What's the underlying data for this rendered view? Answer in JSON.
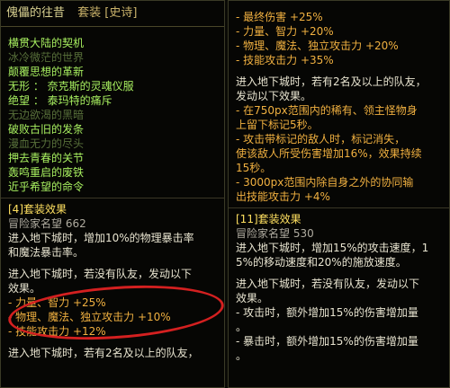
{
  "left": {
    "title": "傀儡的往昔",
    "set_label": "套装 [史诗]",
    "items": [
      {
        "text": "横贯大陆的契机",
        "active": true
      },
      {
        "text": "冰冷微茫的世界",
        "active": false
      },
      {
        "text": "颠覆思想的革新",
        "active": true
      },
      {
        "text": "无形 ： 奈克斯的灵魂仪服",
        "active": true
      },
      {
        "text": "绝望 ： 泰玛特的痛斥",
        "active": true
      },
      {
        "text": "无边欲渴的黑暗",
        "active": false
      },
      {
        "text": "破败古旧的发条",
        "active": true
      },
      {
        "text": "漫血无力的尽头",
        "active": false
      },
      {
        "text": "押去青春的关节",
        "active": true
      },
      {
        "text": "轰鸣重启的废铁",
        "active": true
      },
      {
        "text": "近乎希望的命令",
        "active": true
      }
    ],
    "set4": {
      "header": "[4]套装效果",
      "fame": "冒险家名望 662",
      "desc": [
        "进入地下城时，增加10%的物理暴击率",
        "和魔法暴击率。"
      ],
      "cond": [
        "进入地下城时，若没有队友，发动以下",
        "效果。"
      ],
      "stats": [
        "- 力量、智力 +25%",
        "- 物理、魔法、独立攻击力 +10%",
        "- 技能攻击力 +12%"
      ],
      "cut": "进入地下城时，若有2名及以上的队友，"
    }
  },
  "right": {
    "top_stats": [
      "- 最终伤害 +25%",
      "- 力量、智力 +20%",
      "- 物理、魔法、独立攻击力 +20%",
      "- 技能攻击力 +35%"
    ],
    "party": [
      "进入地下城时，若有2名及以上的队友，",
      "发动以下效果。"
    ],
    "mark": [
      "- 在750px范围内的稀有、领主怪物身",
      "上留下标记5秒。"
    ],
    "mark_attack": [
      "- 攻击带标记的敌人时，标记消失，",
      "使该敌人所受伤害增加16%，效果持续",
      "15秒。"
    ],
    "other": [
      "- 3000px范围内除自身之外的协同输",
      "出技能攻击力 +4%"
    ],
    "set11": {
      "header": "[11]套装效果",
      "fame": "冒险家名望 530",
      "desc": [
        "进入地下城时，增加15%的攻击速度，1",
        "5%的移动速度和20%的施放速度。"
      ],
      "cond": [
        "进入地下城时，若没有队友，发动以下",
        "效果。"
      ],
      "effects": [
        "- 攻击时，额外增加15%的伤害增加量",
        "。",
        "- 暴击时，额外增加15%的伤害增加量",
        "。"
      ]
    }
  },
  "colors": {
    "background": "#060604",
    "active_item": "#a8f060",
    "inactive_item": "#58703a",
    "header": "#ffe060",
    "body_text": "#e8e4d0",
    "stat_text": "#f0b040",
    "annotation_circle": "#d42020"
  }
}
